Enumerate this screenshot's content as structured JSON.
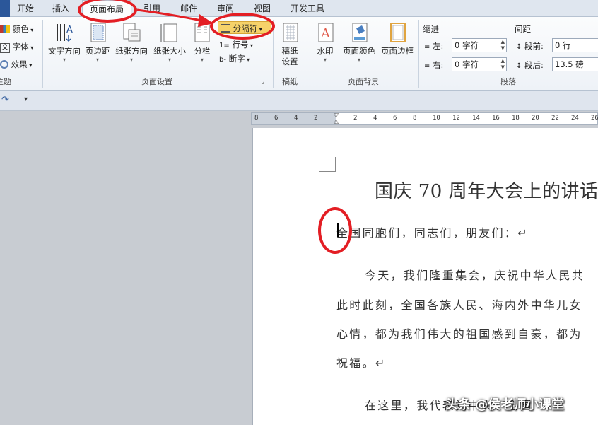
{
  "tabs": [
    "开始",
    "插入",
    "页面布局",
    "引用",
    "邮件",
    "审阅",
    "视图",
    "开发工具"
  ],
  "theme_group": {
    "colors": "颜色",
    "fonts": "字体",
    "effects": "效果",
    "label": "主题"
  },
  "page_setup": {
    "text_direction": "文字方向",
    "margins": "页边距",
    "orientation": "纸张方向",
    "size": "纸张大小",
    "columns": "分栏",
    "breaks": "分隔符",
    "line_numbers": "行号",
    "hyphenation": "断字",
    "label": "页面设置"
  },
  "manuscript": {
    "button": "稿纸设置",
    "label": "稿纸"
  },
  "page_background": {
    "watermark": "水印",
    "page_color": "页面颜色",
    "page_borders": "页面边框",
    "label": "页面背景"
  },
  "paragraph": {
    "indent_title": "缩进",
    "spacing_title": "间距",
    "left_label": "左:",
    "left_value": "0 字符",
    "right_label": "右:",
    "right_value": "0 字符",
    "before_label": "段前:",
    "before_value": "0 行",
    "after_label": "段后:",
    "after_value": "13.5 磅",
    "label": "段落"
  },
  "ruler_numbers": [
    "8",
    "6",
    "4",
    "2",
    "2",
    "4",
    "6",
    "8",
    "10",
    "12",
    "14",
    "16",
    "18",
    "20",
    "22",
    "24",
    "26"
  ],
  "document": {
    "title": "国庆 70 周年大会上的讲话",
    "greeting": "全国同胞们，同志们，朋友们：↵",
    "lines": [
      "今天，我们隆重集会，庆祝中华人民共",
      "此时此刻，全国各族人民、海内外中华儿女",
      "心情，都为我们伟大的祖国感到自豪，都为",
      "祝福。↵",
      "在这里，我代表党中央、全国"
    ]
  },
  "watermark_text": "头条 @侯老师小课堂",
  "colors": {
    "annotation": "#e31e24",
    "highlight": "#f6d26a"
  }
}
